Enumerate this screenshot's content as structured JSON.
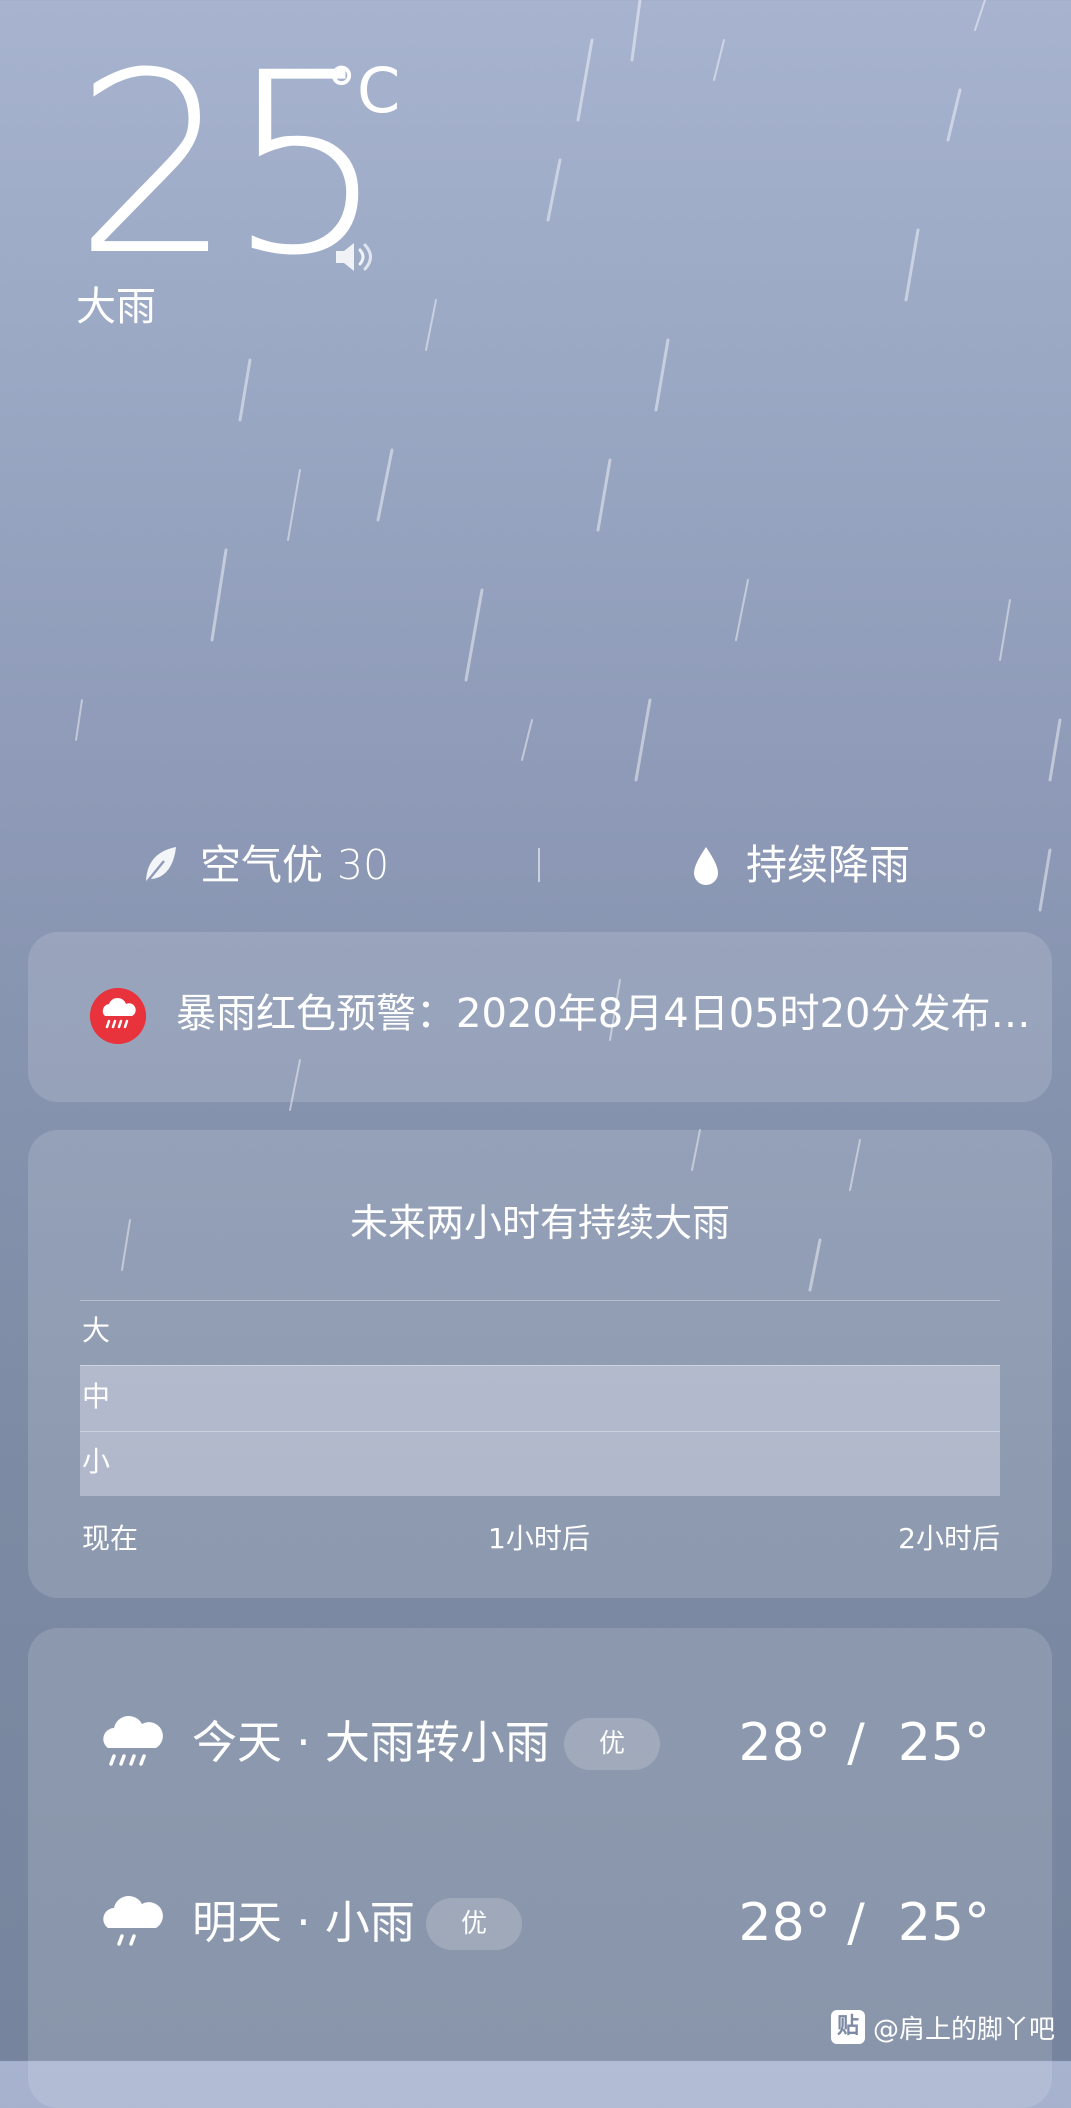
{
  "current": {
    "temperature": "25",
    "unit": "°C",
    "condition": "大雨"
  },
  "info": {
    "air_quality_label": "空气优",
    "air_quality_value": "30",
    "rain_status": "持续降雨"
  },
  "alert": {
    "text": "暴雨红色预警：2020年8月4日05时20分发布…",
    "color": "#e8323c"
  },
  "forecast_2h": {
    "title": "未来两小时有持续大雨",
    "levels": [
      "大",
      "中",
      "小"
    ],
    "time_labels": [
      "现在",
      "1小时后",
      "2小时后"
    ]
  },
  "daily": [
    {
      "label": "今天 · 大雨转小雨",
      "aqi": "优",
      "high": "28°",
      "low": "25°",
      "icon": "heavy-rain-icon"
    },
    {
      "label": "明天 · 小雨",
      "aqi": "优",
      "high": "28°",
      "low": "25°",
      "icon": "light-rain-icon"
    }
  ],
  "watermark": {
    "badge": "贴",
    "text": "@肩上的脚丫吧"
  },
  "chart_data": {
    "type": "area",
    "title": "未来两小时有持续大雨",
    "categories": [
      "现在",
      "1小时后",
      "2小时后"
    ],
    "y_categories": [
      "小",
      "中",
      "大"
    ],
    "series": [
      {
        "values": [
          2.0,
          2.0,
          2.0
        ]
      }
    ],
    "ylim": [
      0,
      3
    ],
    "grid": true
  }
}
